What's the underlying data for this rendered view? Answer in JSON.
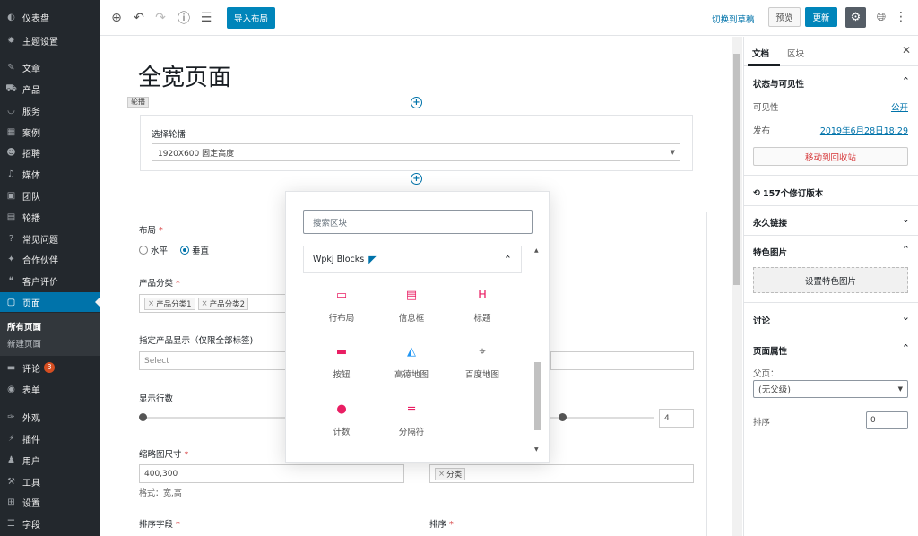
{
  "sidebar": {
    "items": [
      {
        "icon": "dashboard-icon",
        "glyph": "◐",
        "label": "仪表盘",
        "active": false
      },
      {
        "icon": "gear-icon",
        "glyph": "✹",
        "label": "主题设置",
        "active": false
      },
      {
        "icon": "pin-icon",
        "glyph": "✎",
        "label": "文章",
        "active": false
      },
      {
        "icon": "cart-icon",
        "glyph": "⛟",
        "label": "产品",
        "active": false
      },
      {
        "icon": "smile-icon",
        "glyph": "◡",
        "label": "服务",
        "active": false
      },
      {
        "icon": "grid-icon",
        "glyph": "▦",
        "label": "案例",
        "active": false
      },
      {
        "icon": "person-icon",
        "glyph": "☻",
        "label": "招聘",
        "active": false
      },
      {
        "icon": "media-icon",
        "glyph": "♫",
        "label": "媒体",
        "active": false
      },
      {
        "icon": "id-icon",
        "glyph": "▣",
        "label": "团队",
        "active": false
      },
      {
        "icon": "slides-icon",
        "glyph": "▤",
        "label": "轮播",
        "active": false
      },
      {
        "icon": "question-icon",
        "glyph": "?",
        "label": "常见问题",
        "active": false
      },
      {
        "icon": "partner-icon",
        "glyph": "✦",
        "label": "合作伙伴",
        "active": false
      },
      {
        "icon": "quote-icon",
        "glyph": "❝",
        "label": "客户评价",
        "active": false
      },
      {
        "icon": "page-icon",
        "glyph": "▢",
        "label": "页面",
        "active": true
      },
      {
        "icon": "comment-icon",
        "glyph": "▬",
        "label": "评论",
        "badge": "3",
        "active": false
      },
      {
        "icon": "form-icon",
        "glyph": "◉",
        "label": "表单",
        "active": false
      },
      {
        "icon": "brush-icon",
        "glyph": "✑",
        "label": "外观",
        "active": false
      },
      {
        "icon": "plugin-icon",
        "glyph": "⚡",
        "label": "插件",
        "active": false
      },
      {
        "icon": "user-icon",
        "glyph": "♟",
        "label": "用户",
        "active": false
      },
      {
        "icon": "wrench-icon",
        "glyph": "⚒",
        "label": "工具",
        "active": false
      },
      {
        "icon": "settings-icon",
        "glyph": "⊞",
        "label": "设置",
        "active": false
      },
      {
        "icon": "fields-icon",
        "glyph": "☰",
        "label": "字段",
        "active": false
      }
    ],
    "submenu": [
      "所有页面",
      "新建页面"
    ]
  },
  "topbar": {
    "import_label": "导入布局",
    "switch_draft": "切换到草稿",
    "preview": "预览",
    "update": "更新"
  },
  "editor": {
    "title": "全宽页面",
    "carousel_tag": "轮播",
    "select_carousel_label": "选择轮播",
    "select_carousel_value": "1920X600 固定高度",
    "layout_label": "布局",
    "layout_opt1": "水平",
    "layout_opt2": "垂直",
    "category_label": "产品分类",
    "category_chips": [
      "产品分类1",
      "产品分类2"
    ],
    "specific_label": "指定产品显示（仅限全部标签)",
    "specific_placeholder": "Select",
    "rows_label": "显示行数",
    "rows_value": "4",
    "thumb_label": "缩略图尺寸",
    "thumb_value": "400,300",
    "thumb_hint": "格式：宽,高",
    "chip_right": "分类",
    "sort_field_label": "排序字段",
    "sort_label": "排序",
    "required_mark": "*"
  },
  "inserter": {
    "search_placeholder": "搜索区块",
    "panel_title": "Wpkj Blocks",
    "blocks": [
      {
        "icon": "row-layout-icon",
        "glyph": "▭",
        "label": "行布局"
      },
      {
        "icon": "info-box-icon",
        "glyph": "▤",
        "label": "信息框"
      },
      {
        "icon": "heading-icon",
        "glyph": "H",
        "label": "标题"
      },
      {
        "icon": "button-icon",
        "glyph": "▬",
        "label": "按钮"
      },
      {
        "icon": "amap-icon",
        "glyph": "◭",
        "label": "高德地图"
      },
      {
        "icon": "baidu-map-icon",
        "glyph": "⌖",
        "label": "百度地图"
      },
      {
        "icon": "counter-icon",
        "glyph": "●",
        "label": "计数"
      },
      {
        "icon": "separator-icon",
        "glyph": "═",
        "label": "分隔符"
      }
    ]
  },
  "settings": {
    "tab_doc": "文档",
    "tab_block": "区块",
    "status_title": "状态与可见性",
    "visibility_label": "可见性",
    "visibility_value": "公开",
    "publish_label": "发布",
    "publish_value": "2019年6月28日18:29",
    "trash": "移动到回收站",
    "revisions": "157个修订版本",
    "permalink": "永久链接",
    "featured": "特色图片",
    "set_featured": "设置特色图片",
    "discussion": "讨论",
    "page_attrs": "页面属性",
    "parent_label": "父页：",
    "parent_value": "(无父级)",
    "order_label": "排序",
    "order_value": "0"
  },
  "colors": {
    "accent": "#0085ba",
    "sidebar_bg": "#23282d",
    "active": "#0073aa",
    "danger": "#d63638",
    "block_icon": "#e91e63"
  }
}
